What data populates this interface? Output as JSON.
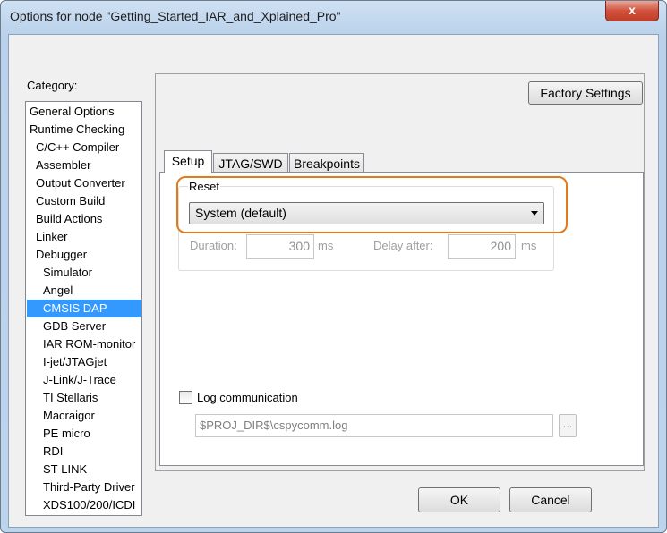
{
  "window": {
    "title": "Options for node \"Getting_Started_IAR_and_Xplained_Pro\"",
    "close_glyph": "x"
  },
  "category": {
    "label": "Category:",
    "items": [
      "General Options",
      "Runtime Checking",
      "C/C++ Compiler",
      "Assembler",
      "Output Converter",
      "Custom Build",
      "Build Actions",
      "Linker",
      "Debugger",
      "Simulator",
      "Angel",
      "CMSIS DAP",
      "GDB Server",
      "IAR ROM-monitor",
      "I-jet/JTAGjet",
      "J-Link/J-Trace",
      "TI Stellaris",
      "Macraigor",
      "PE micro",
      "RDI",
      "ST-LINK",
      "Third-Party Driver",
      "XDS100/200/ICDI"
    ],
    "selected": "CMSIS DAP"
  },
  "factory_settings": "Factory Settings",
  "tabs": [
    "Setup",
    "JTAG/SWD",
    "Breakpoints"
  ],
  "active_tab": "Setup",
  "reset": {
    "label": "Reset",
    "value": "System (default)"
  },
  "duration": {
    "label": "Duration:",
    "value": "300",
    "unit": "ms"
  },
  "delay": {
    "label": "Delay after:",
    "value": "200",
    "unit": "ms"
  },
  "log": {
    "label": "Log communication",
    "checked": false,
    "path": "$PROJ_DIR$\\cspycomm.log",
    "browse": "..."
  },
  "buttons": {
    "ok": "OK",
    "cancel": "Cancel"
  },
  "colors": {
    "selection": "#3399ff",
    "highlight_ring": "#e07b1d"
  }
}
